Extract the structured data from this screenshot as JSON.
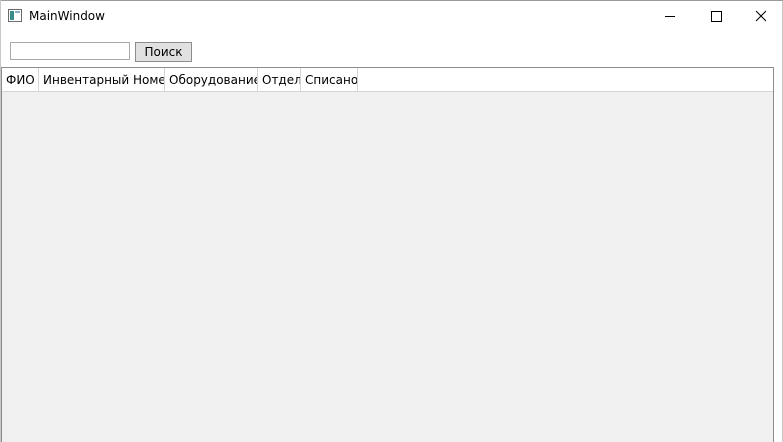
{
  "window": {
    "title": "MainWindow",
    "icons": {
      "app": "app-window-icon",
      "minimize": "minimize-icon",
      "maximize": "maximize-icon",
      "close": "close-icon"
    }
  },
  "toolbar": {
    "search_value": "",
    "search_placeholder": "",
    "search_button_label": "Поиск"
  },
  "grid": {
    "columns": [
      "ФИО",
      "Инвентарный Номер",
      "Оборудование",
      "Отдел",
      "Списано"
    ],
    "rows": []
  },
  "colors": {
    "grid_background": "#f0f0f0",
    "button_background": "#e1e1e1",
    "header_background": "#ffffff"
  }
}
